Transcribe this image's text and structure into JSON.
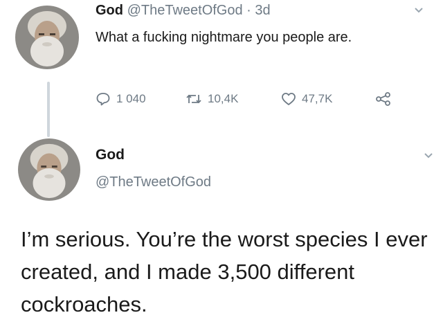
{
  "tweet1": {
    "name": "God",
    "handle": "@TheTweetOfGod",
    "separator": "·",
    "time": "3d",
    "text": "What a fucking nightmare you people are.",
    "avatar_icon": "bearded-man-avatar",
    "actions": {
      "replies": "1 040",
      "retweets": "10,4K",
      "likes": "47,7K"
    }
  },
  "tweet2": {
    "name": "God",
    "handle": "@TheTweetOfGod",
    "text": "I’m serious. You’re the worst species I ever created, and I made 3,500 different cockroaches.",
    "avatar_icon": "bearded-man-avatar"
  },
  "colors": {
    "text": "#1a1a1a",
    "muted": "#6e7a85",
    "thread_line": "#cfd6dc"
  }
}
